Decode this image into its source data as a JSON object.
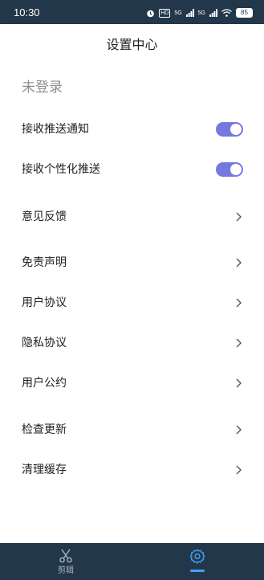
{
  "status_bar": {
    "time": "10:30",
    "battery": "85",
    "signal_1": "5G",
    "signal_2": "5G",
    "hd": "HD"
  },
  "header": {
    "title": "设置中心"
  },
  "account": {
    "login_status": "未登录"
  },
  "settings": {
    "push_notifications": {
      "label": "接收推送通知",
      "enabled": true
    },
    "personalized_push": {
      "label": "接收个性化推送",
      "enabled": true
    },
    "feedback": {
      "label": "意见反馈"
    },
    "disclaimer": {
      "label": "免责声明"
    },
    "user_agreement": {
      "label": "用户协议"
    },
    "privacy_agreement": {
      "label": "隐私协议"
    },
    "user_convention": {
      "label": "用户公约"
    },
    "check_update": {
      "label": "检查更新"
    },
    "clear_cache": {
      "label": "清理缓存"
    }
  },
  "bottom_nav": {
    "items": [
      {
        "label": "剪辑",
        "icon": "scissors-icon",
        "active": false
      },
      {
        "label": "",
        "icon": "gear-icon",
        "active": true
      }
    ]
  },
  "colors": {
    "toggle_on": "#7479df",
    "bar_background": "#22384a",
    "active_indicator": "#49a0ff",
    "muted_text": "#8e8e8e"
  }
}
